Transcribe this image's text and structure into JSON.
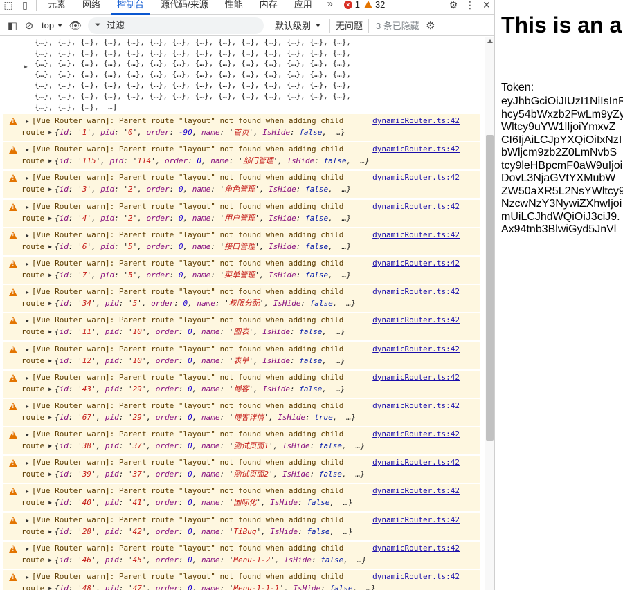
{
  "tabbar": {
    "tabs": [
      "元素",
      "网络",
      "控制台",
      "源代码/来源",
      "性能",
      "内存",
      "应用"
    ],
    "active_tab": "控制台",
    "more_label": "»",
    "error_count": "1",
    "warning_count": "32"
  },
  "toolbar": {
    "context": "top",
    "filter_placeholder": "过滤",
    "level": "默认级别",
    "issues": "无问题",
    "hidden": "3 条已隐藏"
  },
  "console": {
    "array_line": "{…}, {…}, {…}, {…}, {…}, {…}, {…}, {…}, {…}, {…}, {…}, {…}, {…}, {…},",
    "array_last": "{…}, {…}, {…},  …]",
    "warn_prefix": "[Vue Router warn]: Parent route \"layout\" not found when adding child",
    "source": "dynamicRouter.ts:42",
    "route_label": "route",
    "entries": [
      {
        "id": "1",
        "pid": "0",
        "order": "-90",
        "name": "首页",
        "hide": "false"
      },
      {
        "id": "115",
        "pid": "114",
        "order": "0",
        "name": "部门管理",
        "hide": "false"
      },
      {
        "id": "3",
        "pid": "2",
        "order": "0",
        "name": "角色管理",
        "hide": "false"
      },
      {
        "id": "4",
        "pid": "2",
        "order": "0",
        "name": "用户管理",
        "hide": "false"
      },
      {
        "id": "6",
        "pid": "5",
        "order": "0",
        "name": "接口管理",
        "hide": "false"
      },
      {
        "id": "7",
        "pid": "5",
        "order": "0",
        "name": "菜单管理",
        "hide": "false"
      },
      {
        "id": "34",
        "pid": "5",
        "order": "0",
        "name": "权限分配",
        "hide": "false"
      },
      {
        "id": "11",
        "pid": "10",
        "order": "0",
        "name": "图表",
        "hide": "false"
      },
      {
        "id": "12",
        "pid": "10",
        "order": "0",
        "name": "表单",
        "hide": "false"
      },
      {
        "id": "43",
        "pid": "29",
        "order": "0",
        "name": "博客",
        "hide": "false"
      },
      {
        "id": "67",
        "pid": "29",
        "order": "0",
        "name": "博客详情",
        "hide": "true"
      },
      {
        "id": "38",
        "pid": "37",
        "order": "0",
        "name": "测试页面1",
        "hide": "false"
      },
      {
        "id": "39",
        "pid": "37",
        "order": "0",
        "name": "测试页面2",
        "hide": "false"
      },
      {
        "id": "40",
        "pid": "41",
        "order": "0",
        "name": "国际化",
        "hide": "false"
      },
      {
        "id": "28",
        "pid": "42",
        "order": "0",
        "name": "TiBug",
        "hide": "false"
      },
      {
        "id": "46",
        "pid": "45",
        "order": "0",
        "name": "Menu-1-2",
        "hide": "false"
      },
      {
        "id": "48",
        "pid": "47",
        "order": "0",
        "name": "Menu-1-1-1",
        "hide": "false"
      }
    ]
  },
  "page": {
    "heading": "This is an a",
    "token_label": "Token:",
    "token_lines": [
      "eyJhbGciOiJIUzI1NiIsInR",
      "hcy54bWxzb2FwLm9yZy",
      "Wltcy9uYW1lIjoiYmxvZ",
      "CI6IjAiLCJpYXQiOiIxNzI",
      "bWljcm9zb2Z0LmNvbS",
      "tcy9leHBpcmF0aW9uIjoi",
      "DovL3NjaGVtYXMubW",
      "ZW50aXR5L2NsYWltcy9",
      "NzcwNzY3NywiZXhwIjoi",
      "mUiLCJhdWQiOiJ3ciJ9.",
      "Ax94tnb3BlwiGyd5JnVl"
    ]
  }
}
